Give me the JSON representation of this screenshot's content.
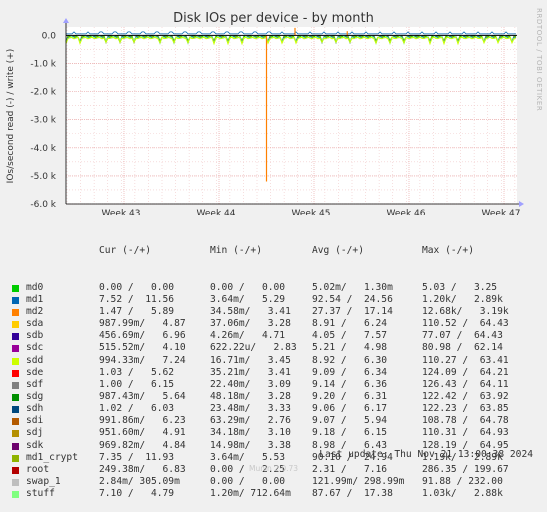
{
  "chart_data": {
    "type": "line",
    "title": "Disk IOs per device - by month",
    "ylabel": "IOs/second read (-) / write (+)",
    "xlabel": "",
    "ylim": [
      -6000,
      300
    ],
    "yticks": [
      {
        "value": 0,
        "label": "0.0"
      },
      {
        "value": -1000,
        "label": "-1.0 k"
      },
      {
        "value": -2000,
        "label": "-2.0 k"
      },
      {
        "value": -3000,
        "label": "-3.0 k"
      },
      {
        "value": -4000,
        "label": "-4.0 k"
      },
      {
        "value": -5000,
        "label": "-5.0 k"
      },
      {
        "value": -6000,
        "label": "-6.0 k"
      }
    ],
    "xticks": [
      "Week 43",
      "Week 44",
      "Week 45",
      "Week 46",
      "Week 47"
    ],
    "grid": true,
    "spikes": [
      {
        "series": "md2",
        "x_week": 44.5,
        "read": -5200,
        "write": 0
      },
      {
        "series": "md2",
        "x_week": 44.8,
        "read": 0,
        "write": 270
      },
      {
        "series": "md2",
        "x_week": 45.35,
        "read": -30,
        "write": 150
      }
    ],
    "columns": [
      "Cur (-/+)",
      "Min (-/+)",
      "Avg (-/+)",
      "Max (-/+)"
    ],
    "series": [
      {
        "name": "md0",
        "color": "#00cc00",
        "cur": "0.00 /   0.00",
        "min": "0.00 /   0.00",
        "avg": "5.02m/   1.30m",
        "max": "5.03 /   3.25"
      },
      {
        "name": "md1",
        "color": "#0066b3",
        "cur": "7.52 /  11.56",
        "min": "3.64m/   5.29",
        "avg": "92.54 /  24.56",
        "max": "1.20k/   2.89k"
      },
      {
        "name": "md2",
        "color": "#ff8000",
        "cur": "1.47 /   5.89",
        "min": "34.58m/   3.41",
        "avg": "27.37 /  17.14",
        "max": "12.68k/   3.19k"
      },
      {
        "name": "sda",
        "color": "#ffcc00",
        "cur": "987.99m/   4.87",
        "min": "37.06m/   3.28",
        "avg": "8.91 /   6.24",
        "max": "110.52 /  64.43"
      },
      {
        "name": "sdb",
        "color": "#330099",
        "cur": "456.69m/   6.96",
        "min": "4.26m/   4.71",
        "avg": "4.05 /   7.57",
        "max": "77.07 /  64.43"
      },
      {
        "name": "sdc",
        "color": "#990099",
        "cur": "515.52m/   4.10",
        "min": "622.22u/   2.83",
        "avg": "5.21 /   4.98",
        "max": "80.98 /  62.14"
      },
      {
        "name": "sdd",
        "color": "#ccff00",
        "cur": "994.33m/   7.24",
        "min": "16.71m/   3.45",
        "avg": "8.92 /   6.30",
        "max": "110.27 /  63.41"
      },
      {
        "name": "sde",
        "color": "#ff0000",
        "cur": "1.03 /   5.62",
        "min": "35.21m/   3.41",
        "avg": "9.09 /   6.34",
        "max": "124.09 /  64.21"
      },
      {
        "name": "sdf",
        "color": "#808080",
        "cur": "1.00 /   6.15",
        "min": "22.40m/   3.09",
        "avg": "9.14 /   6.36",
        "max": "126.43 /  64.11"
      },
      {
        "name": "sdg",
        "color": "#008f00",
        "cur": "987.43m/   5.64",
        "min": "48.18m/   3.28",
        "avg": "9.20 /   6.31",
        "max": "122.42 /  63.92"
      },
      {
        "name": "sdh",
        "color": "#00487d",
        "cur": "1.02 /   6.03",
        "min": "23.48m/   3.33",
        "avg": "9.06 /   6.17",
        "max": "122.23 /  63.85"
      },
      {
        "name": "sdi",
        "color": "#b35a00",
        "cur": "991.86m/   6.23",
        "min": "63.29m/   2.76",
        "avg": "9.07 /   5.94",
        "max": "108.78 /  64.78"
      },
      {
        "name": "sdj",
        "color": "#b38f00",
        "cur": "951.60m/   4.91",
        "min": "34.18m/   3.10",
        "avg": "9.18 /   6.15",
        "max": "110.31 /  64.93"
      },
      {
        "name": "sdk",
        "color": "#6b006b",
        "cur": "969.82m/   4.84",
        "min": "14.98m/   3.38",
        "avg": "8.98 /   6.43",
        "max": "128.19 /  64.95"
      },
      {
        "name": "md1_crypt",
        "color": "#8fb300",
        "cur": "7.35 /  11.93",
        "min": "3.64m/   5.53",
        "avg": "90.10 /  24.94",
        "max": "1.19k/   2.89k"
      },
      {
        "name": "root",
        "color": "#b30000",
        "cur": "249.38m/   6.83",
        "min": "0.00 /   2.25",
        "avg": "2.31 /   7.16",
        "max": "286.35 / 199.67"
      },
      {
        "name": "swap_1",
        "color": "#bebebe",
        "cur": "2.84m/ 305.09m",
        "min": "0.00 /   0.00",
        "avg": "121.99m/ 298.99m",
        "max": "91.88 / 232.00"
      },
      {
        "name": "stuff",
        "color": "#80ff80",
        "cur": "7.10 /   4.79",
        "min": "1.20m/ 712.64m",
        "avg": "87.67 /  17.38",
        "max": "1.03k/   2.88k"
      }
    ]
  },
  "header": {
    "cur": "Cur (-/+)",
    "min": "Min (-/+)",
    "avg": "Avg (-/+)",
    "max": "Max (-/+)"
  },
  "side_note": "RRDTOOL / TOBI OETIKER",
  "last_update": "Last update: Thu Nov 21 13:00:38 2024",
  "footer": "Munin 2.0.73"
}
